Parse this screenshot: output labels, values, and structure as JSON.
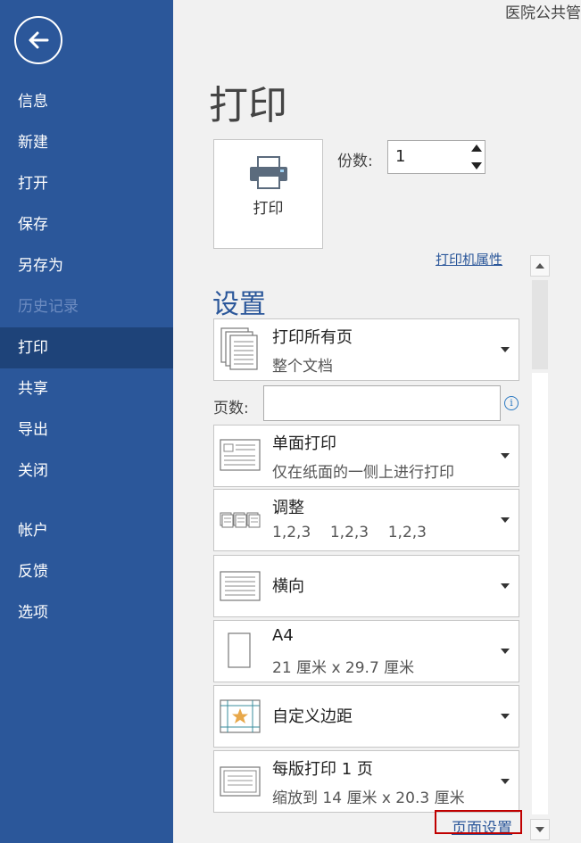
{
  "doc_title": "医院公共管",
  "sidebar": {
    "items": [
      {
        "label": "信息"
      },
      {
        "label": "新建"
      },
      {
        "label": "打开"
      },
      {
        "label": "保存"
      },
      {
        "label": "另存为"
      },
      {
        "label": "历史记录"
      },
      {
        "label": "打印"
      },
      {
        "label": "共享"
      },
      {
        "label": "导出"
      },
      {
        "label": "关闭"
      },
      {
        "label": "帐户"
      },
      {
        "label": "反馈"
      },
      {
        "label": "选项"
      }
    ]
  },
  "print": {
    "title": "打印",
    "button_label": "打印",
    "copies_label": "份数:",
    "copies_value": "1",
    "printer_properties": "打印机属性"
  },
  "settings": {
    "title": "设置",
    "pages_label": "页数:",
    "pages_placeholder": "",
    "print_range": {
      "main": "打印所有页",
      "sub": "整个文档"
    },
    "sides": {
      "main": "单面打印",
      "sub": "仅在纸面的一侧上进行打印"
    },
    "collate": {
      "main": "调整",
      "sub": "1,2,3    1,2,3    1,2,3"
    },
    "orientation": {
      "main": "横向"
    },
    "paper": {
      "main": "A4",
      "sub": "21 厘米 x 29.7 厘米"
    },
    "margins": {
      "main": "自定义边距"
    },
    "pages_per_sheet": {
      "main": "每版打印 1 页",
      "sub": "缩放到 14 厘米 x 20.3 厘米"
    },
    "page_setup_link": "页面设置"
  },
  "colors": {
    "sidebar": "#2b579a",
    "accent": "#2b579a",
    "highlight": "#c00000"
  }
}
